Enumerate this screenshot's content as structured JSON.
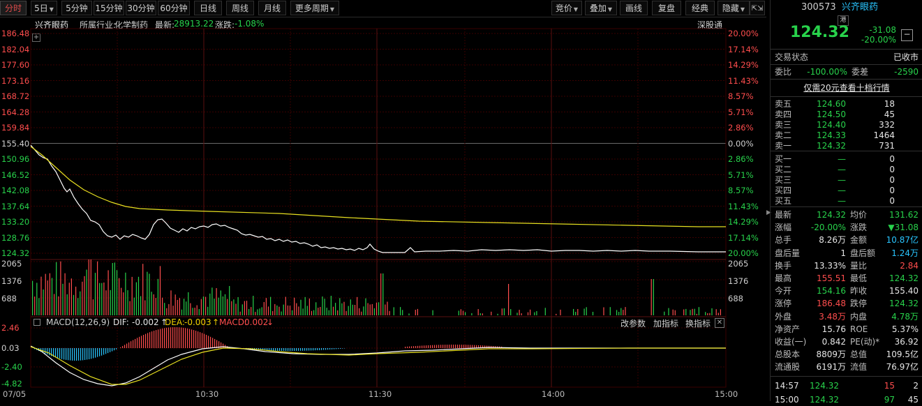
{
  "toolbar": {
    "periods": [
      "分时",
      "5日",
      "5分钟",
      "15分钟",
      "30分钟",
      "60分钟",
      "日线",
      "周线",
      "月线",
      "更多周期"
    ],
    "right_tools": [
      "竞价",
      "叠加",
      "画线",
      "复盘",
      "经典",
      "隐藏"
    ],
    "expand_icon": "⇱⇲"
  },
  "chart_header": {
    "name": "兴齐眼药",
    "industry_label": "所属行业:",
    "industry": "化学制药",
    "latest_label": "最新:",
    "latest": "28913.22",
    "change_label": "涨跌:",
    "change": "-1.08%",
    "right_link": "深股通"
  },
  "price_axis_left": [
    "186.48",
    "182.04",
    "177.60",
    "173.16",
    "168.72",
    "164.28",
    "159.84",
    "155.40",
    "150.96",
    "146.52",
    "142.08",
    "137.64",
    "133.20",
    "128.76",
    "124.32"
  ],
  "price_axis_right": [
    "20.00%",
    "17.14%",
    "14.29%",
    "11.43%",
    "8.57%",
    "5.71%",
    "2.86%",
    "0.00%",
    "2.86%",
    "5.71%",
    "8.57%",
    "11.43%",
    "14.29%",
    "17.14%",
    "20.00%"
  ],
  "volume_axis": [
    "2065",
    "1376",
    "688"
  ],
  "macd": {
    "title": "MACD",
    "params": "(12,26,9)",
    "dif_label": "DIF:",
    "dif": "-0.002",
    "dea_label": "DEA:",
    "dea": "-0.003",
    "macd_label": "MACD:",
    "macd": "0.002",
    "axis": [
      "2.46",
      "0.03",
      "-2.40",
      "-4.82"
    ],
    "buttons": [
      "改参数",
      "加指标",
      "换指标"
    ]
  },
  "time_axis": [
    "07/05",
    "10:30",
    "11:30",
    "14:00",
    "15:00"
  ],
  "colors": {
    "up": "#ff4d4d",
    "down": "#28d24b",
    "price_line": "#ffffff",
    "avg_line": "#e8e020",
    "grid": "#3a0000"
  },
  "quote": {
    "code": "300573",
    "name": "兴齐眼药",
    "badge": "港",
    "price": "124.32",
    "change": "-31.08",
    "pct": "-20.00%",
    "status_label": "交易状态",
    "status": "已收市",
    "weibi_label": "委比",
    "weibi": "-100.00%",
    "weicha_label": "委差",
    "weicha": "-2590",
    "level10_link": "仅需20元查看十档行情",
    "sells": [
      {
        "label": "卖五",
        "price": "124.60",
        "vol": "18"
      },
      {
        "label": "卖四",
        "price": "124.50",
        "vol": "45"
      },
      {
        "label": "卖三",
        "price": "124.40",
        "vol": "332"
      },
      {
        "label": "卖二",
        "price": "124.33",
        "vol": "1464"
      },
      {
        "label": "卖一",
        "price": "124.32",
        "vol": "731"
      }
    ],
    "buys": [
      {
        "label": "买一",
        "price": "—",
        "vol": "0"
      },
      {
        "label": "买二",
        "price": "—",
        "vol": "0"
      },
      {
        "label": "买三",
        "price": "—",
        "vol": "0"
      },
      {
        "label": "买四",
        "price": "—",
        "vol": "0"
      },
      {
        "label": "买五",
        "price": "—",
        "vol": "0"
      }
    ],
    "stats": [
      {
        "l1": "最新",
        "v1": "124.32",
        "c1": "green",
        "l2": "均价",
        "v2": "131.62",
        "c2": "green"
      },
      {
        "l1": "涨幅",
        "v1": "-20.00%",
        "c1": "green",
        "l2": "涨跌",
        "v2": "▼31.08",
        "c2": "green"
      },
      {
        "l1": "总手",
        "v1": "8.26万",
        "c1": "white",
        "l2": "金额",
        "v2": "10.87亿",
        "c2": "cyan"
      },
      {
        "l1": "盘后量",
        "v1": "1",
        "c1": "white",
        "l2": "盘后额",
        "v2": "1.24万",
        "c2": "cyan"
      },
      {
        "l1": "换手",
        "v1": "13.33%",
        "c1": "white",
        "l2": "量比",
        "v2": "2.84",
        "c2": "red"
      },
      {
        "l1": "最高",
        "v1": "155.51",
        "c1": "red",
        "l2": "最低",
        "v2": "124.32",
        "c2": "green"
      },
      {
        "l1": "今开",
        "v1": "154.16",
        "c1": "green",
        "l2": "昨收",
        "v2": "155.40",
        "c2": "white"
      },
      {
        "l1": "涨停",
        "v1": "186.48",
        "c1": "red",
        "l2": "跌停",
        "v2": "124.32",
        "c2": "green"
      },
      {
        "l1": "外盘",
        "v1": "3.48万",
        "c1": "red",
        "l2": "内盘",
        "v2": "4.78万",
        "c2": "green"
      },
      {
        "l1": "净资产",
        "v1": "15.76",
        "c1": "white",
        "l2": "ROE",
        "v2": "5.37%",
        "c2": "white"
      },
      {
        "l1": "收益(一)",
        "v1": "0.842",
        "c1": "white",
        "l2": "PE(动)*",
        "v2": "36.92",
        "c2": "white"
      },
      {
        "l1": "总股本",
        "v1": "8809万",
        "c1": "white",
        "l2": "总值",
        "v2": "109.5亿",
        "c2": "white"
      },
      {
        "l1": "流通股",
        "v1": "6191万",
        "c1": "white",
        "l2": "流值",
        "v2": "76.97亿",
        "c2": "white"
      }
    ],
    "ticks": [
      {
        "time": "14:57",
        "price": "124.32",
        "vol": "15",
        "num": "2"
      },
      {
        "time": "15:00",
        "price": "124.32",
        "vol": "97",
        "num": "45"
      }
    ]
  }
}
